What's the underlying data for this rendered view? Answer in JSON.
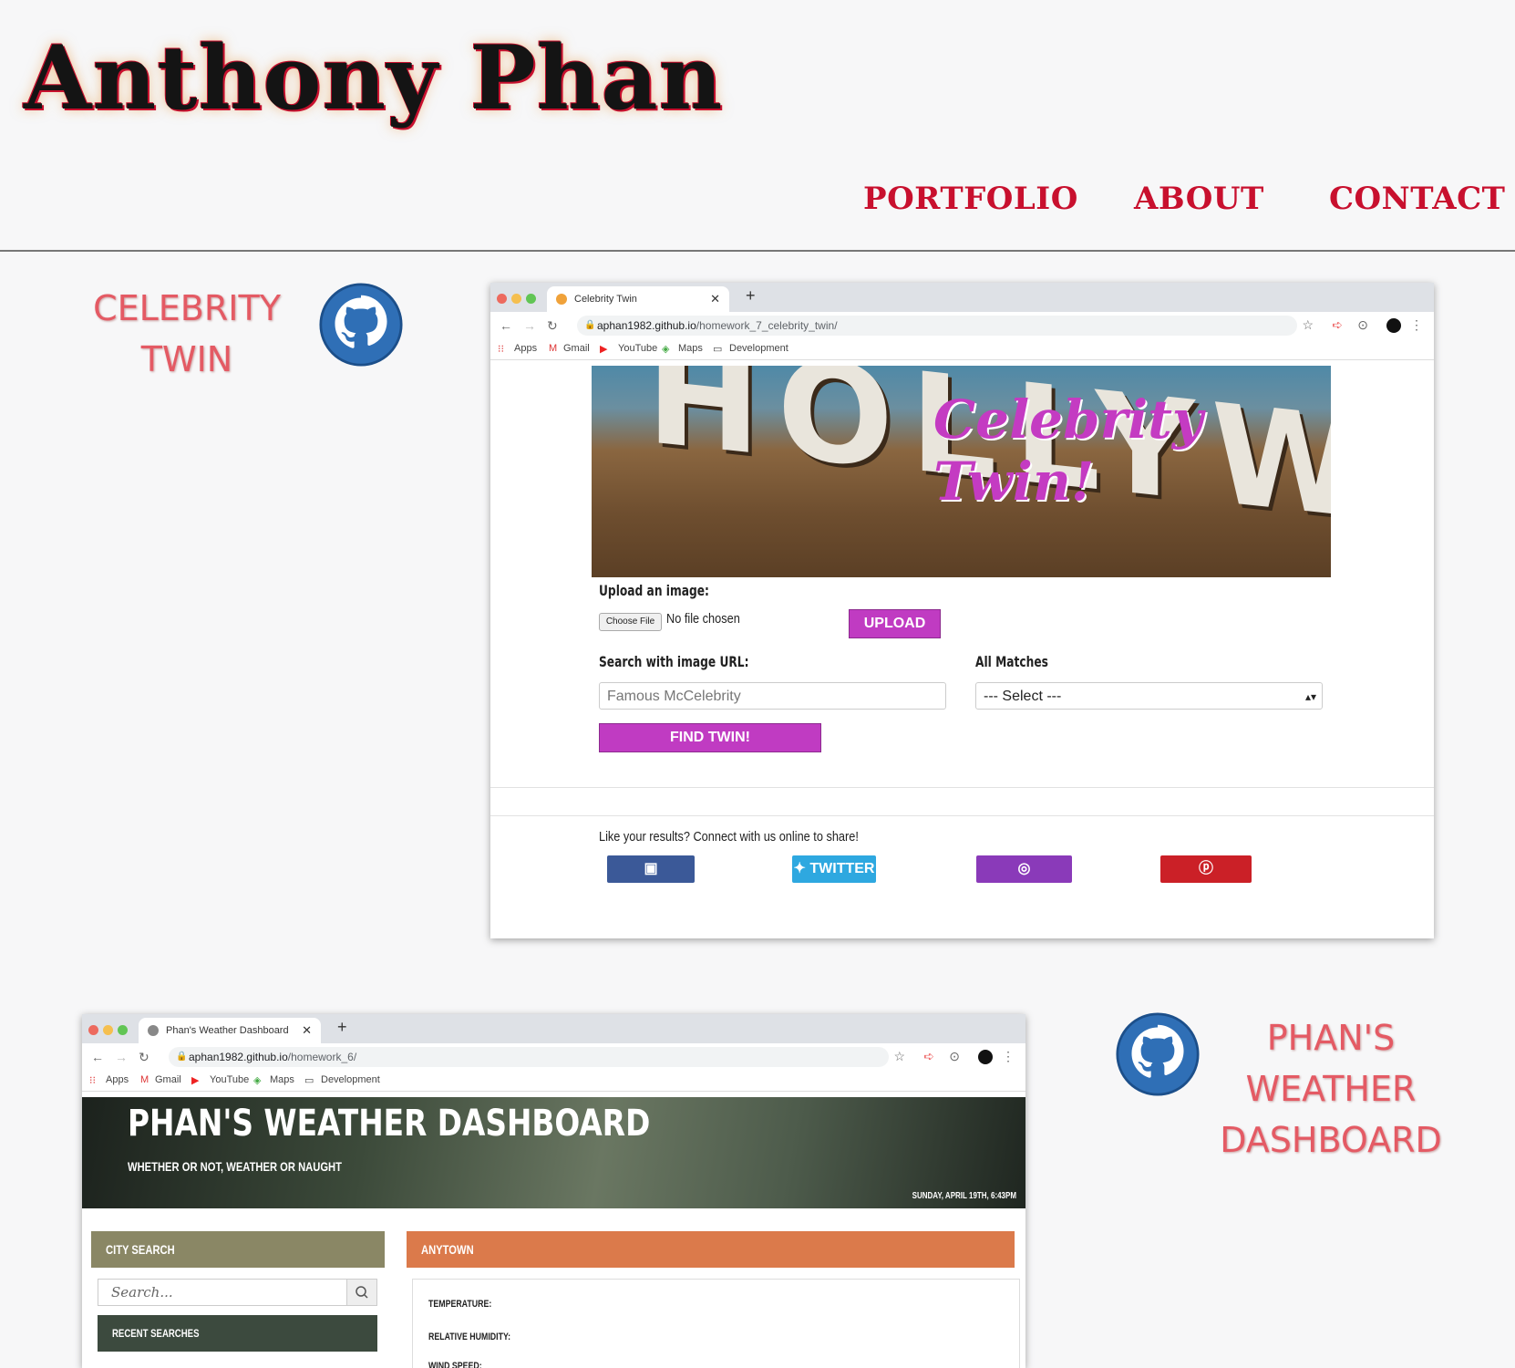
{
  "header": {
    "site_title": "Anthony Phan",
    "nav": [
      "PORTFOLIO",
      "ABOUT",
      "CONTACT"
    ]
  },
  "projects": [
    {
      "title_line1": "CELEBRITY",
      "title_line2": "TWIN",
      "browser": {
        "tab_title": "Celebrity Twin",
        "url_host": "aphan1982.github.io",
        "url_path": "/homework_7_celebrity_twin/",
        "bookmarks": [
          "Apps",
          "Gmail",
          "YouTube",
          "Maps",
          "Development"
        ]
      },
      "page": {
        "hero_letters": "HOLLYWOOD",
        "hero_script": "Celebrity Twin!",
        "upload_label": "Upload an image:",
        "choose_file": "Choose File",
        "no_file": "No file chosen",
        "upload_button": "UPLOAD",
        "url_label": "Search with image URL:",
        "url_placeholder": "Famous McCelebrity",
        "matches_label": "All Matches",
        "matches_selected": "--- Select ---",
        "find_button": "FIND TWIN!",
        "share_text": "Like your results? Connect with us online to share!",
        "social": [
          {
            "label": "FACEBOOK",
            "color": "#3b5998"
          },
          {
            "label": "TWITTER",
            "color": "#2ea8e0"
          },
          {
            "label": "INSTAGRAM",
            "color": "#8a3ab9"
          },
          {
            "label": "PINTEREST",
            "color": "#cb2027"
          }
        ]
      }
    },
    {
      "title_line1": "PHAN'S",
      "title_line2": "WEATHER",
      "title_line3": "DASHBOARD",
      "browser": {
        "tab_title": "Phan's Weather Dashboard",
        "url_host": "aphan1982.github.io",
        "url_path": "/homework_6/",
        "bookmarks": [
          "Apps",
          "Gmail",
          "YouTube",
          "Maps",
          "Development"
        ]
      },
      "page": {
        "heading": "PHAN'S WEATHER DASHBOARD",
        "subheading": "WHETHER OR NOT, WEATHER OR NAUGHT",
        "date": "SUNDAY, APRIL 19TH, 6:43PM",
        "city_search_label": "CITY SEARCH",
        "search_placeholder": "Search...",
        "recent_searches_label": "RECENT SEARCHES",
        "city_name": "ANYTOWN",
        "temperature_label": "TEMPERATURE:",
        "humidity_label": "RELATIVE HUMIDITY:",
        "wind_label": "WIND SPEED:"
      }
    }
  ],
  "colors": {
    "accent_red": "#c8102e",
    "magenta": "#c03bc2",
    "city_search_bg": "#8a8765",
    "recent_bg": "#3c4a3e",
    "city_bg": "#db7a4b"
  }
}
